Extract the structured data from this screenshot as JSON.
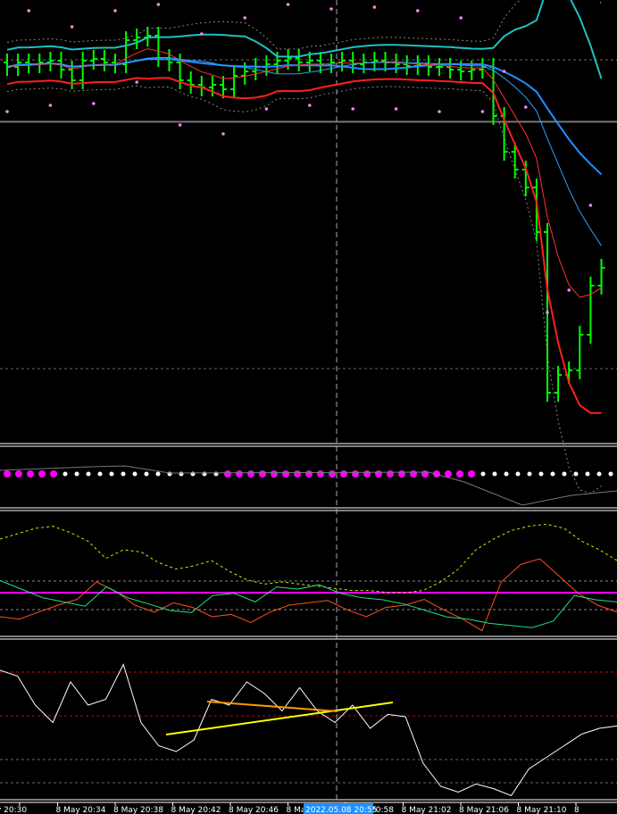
{
  "chart_data": {
    "type": "bar",
    "title": "",
    "xlabel": "",
    "ylabel": "",
    "time_labels": [
      "y 20:30",
      "8 May 20:34",
      "8 May 20:38",
      "8 May 20:42",
      "8 May 20:46",
      "8 May 20",
      "8 May 20:58",
      "8 May 21:02",
      "8 May 21:06",
      "8 May 21:10",
      "8"
    ],
    "crosshair_label": "2022.05.08 20:55",
    "closes": [
      425,
      430,
      428,
      430,
      432,
      422,
      410,
      432,
      434,
      430,
      428,
      455,
      458,
      460,
      435,
      430,
      410,
      405,
      402,
      405,
      400,
      415,
      420,
      425,
      428,
      432,
      435,
      430,
      432,
      428,
      430,
      432,
      428,
      430,
      432,
      430,
      428,
      426,
      428,
      425,
      425,
      422,
      420,
      422,
      425,
      370,
      330,
      310,
      290,
      240,
      60,
      80,
      85,
      125,
      180,
      200
    ],
    "dots": {
      "colors": [
        "#ff00ff",
        "#ff00ff",
        "#ff00ff",
        "#ff00ff",
        "#ff00ff",
        "#fff",
        "#fff",
        "#fff",
        "#fff",
        "#fff",
        "#fff",
        "#fff",
        "#fff",
        "#fff",
        "#fff",
        "#fff",
        "#fff",
        "#fff",
        "#fff",
        "#ff00ff",
        "#ff00ff",
        "#ff00ff",
        "#ff00ff",
        "#ff00ff",
        "#ff00ff",
        "#ff00ff",
        "#ff00ff",
        "#ff00ff",
        "#ff00ff",
        "#ff00ff",
        "#ff00ff",
        "#ff00ff",
        "#ff00ff",
        "#ff00ff",
        "#ff00ff",
        "#ff00ff",
        "#ff00ff",
        "#ff00ff",
        "#ff00ff",
        "#ff00ff",
        "#ff00ff",
        "#fff",
        "#fff",
        "#fff",
        "#fff",
        "#fff",
        "#fff",
        "#fff",
        "#fff",
        "#fff",
        "#fff",
        "#fff",
        "#fff"
      ]
    },
    "osc": {
      "yellow": [
        20,
        15,
        10,
        8,
        14,
        22,
        38,
        30,
        32,
        42,
        48,
        45,
        40,
        50,
        58,
        62,
        60,
        62,
        64,
        66,
        68,
        68,
        70,
        70,
        68,
        60,
        48,
        30,
        20,
        12,
        8,
        6,
        10,
        22,
        30,
        40
      ],
      "red": [
        70,
        72,
        66,
        60,
        55,
        40,
        48,
        60,
        66,
        58,
        62,
        70,
        68,
        75,
        66,
        60,
        58,
        56,
        64,
        70,
        62,
        60,
        55,
        64,
        72,
        82,
        40,
        25,
        20,
        35,
        50,
        60,
        66
      ],
      "green": [
        42,
        50,
        58,
        62,
        66,
        48,
        58,
        64,
        70,
        72,
        56,
        54,
        62,
        48,
        50,
        46,
        54,
        58,
        60,
        64,
        70,
        76,
        78,
        82,
        84,
        86,
        80,
        56,
        60,
        62
      ]
    },
    "bottom": {
      "white": [
        10,
        15,
        40,
        55,
        20,
        40,
        35,
        5,
        55,
        75,
        80,
        70,
        35,
        40,
        20,
        30,
        45,
        25,
        45,
        55,
        40,
        60,
        48,
        50,
        90,
        110,
        115,
        108,
        112,
        118,
        95,
        85,
        75,
        65,
        60,
        58
      ]
    }
  }
}
